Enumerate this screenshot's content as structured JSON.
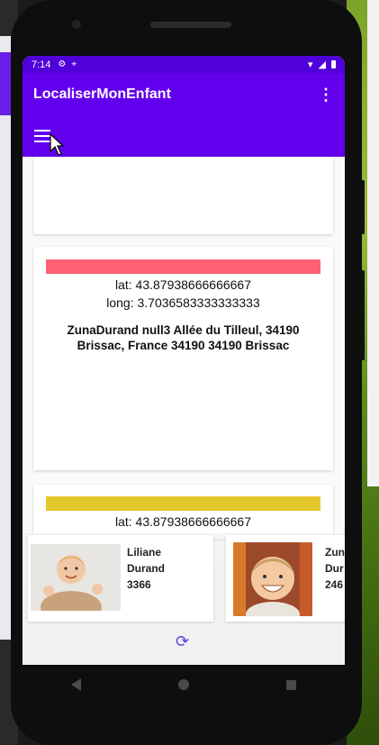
{
  "status_bar": {
    "time": "7:14",
    "icons": [
      "settings-icon",
      "location-icon"
    ],
    "right_icons": [
      "wifi-icon",
      "signal-icon",
      "battery-icon"
    ]
  },
  "app_bar": {
    "title": "LocaliserMonEnfant",
    "overflow_icon": "more-vert-icon",
    "nav_icon": "hamburger-menu-icon"
  },
  "locations": [
    {
      "color": "#ff6174",
      "lat": "lat: 43.87938666666667",
      "long": "long: 3.7036583333333333",
      "address": "ZunaDurand null3 Allée du Tilleul, 34190 Brissac, France  34190 34190 Brissac"
    },
    {
      "color": "#e4c72c",
      "lat": "lat: 43.87938666666667"
    }
  ],
  "children": [
    {
      "first_name": "Liliane",
      "last_name": "Durand",
      "code": "3366"
    },
    {
      "first_name": "Zun",
      "last_name": "Dur",
      "code": "246"
    }
  ],
  "refresh_icon": "refresh-icon",
  "nav_bar": [
    "back-icon",
    "home-icon",
    "recents-icon"
  ]
}
